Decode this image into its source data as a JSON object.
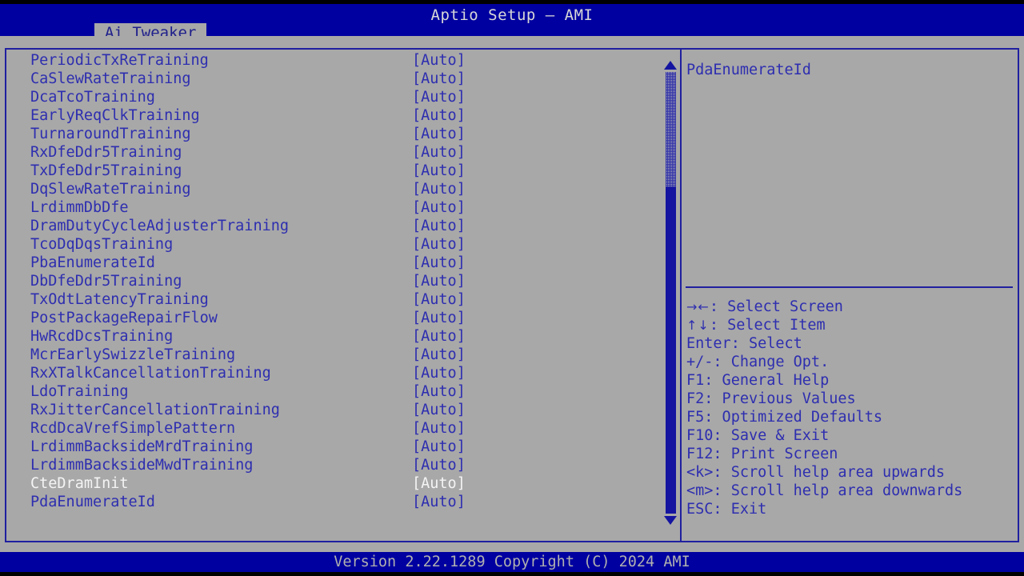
{
  "header": {
    "title": "Aptio Setup – AMI"
  },
  "tabs": [
    {
      "label": "Ai Tweaker",
      "active": true
    }
  ],
  "settings": {
    "selected_index": 23,
    "rows": [
      {
        "label": "PeriodicTxReTraining",
        "value": "[Auto]"
      },
      {
        "label": "CaSlewRateTraining",
        "value": "[Auto]"
      },
      {
        "label": "DcaTcoTraining",
        "value": "[Auto]"
      },
      {
        "label": "EarlyReqClkTraining",
        "value": "[Auto]"
      },
      {
        "label": "TurnaroundTraining",
        "value": "[Auto]"
      },
      {
        "label": "RxDfeDdr5Training",
        "value": "[Auto]"
      },
      {
        "label": "TxDfeDdr5Training",
        "value": "[Auto]"
      },
      {
        "label": "DqSlewRateTraining",
        "value": "[Auto]"
      },
      {
        "label": "LrdimmDbDfe",
        "value": "[Auto]"
      },
      {
        "label": "DramDutyCycleAdjusterTraining",
        "value": "[Auto]"
      },
      {
        "label": "TcoDqDqsTraining",
        "value": "[Auto]"
      },
      {
        "label": "PbaEnumerateId",
        "value": "[Auto]"
      },
      {
        "label": "DbDfeDdr5Training",
        "value": "[Auto]"
      },
      {
        "label": "TxOdtLatencyTraining",
        "value": "[Auto]"
      },
      {
        "label": "PostPackageRepairFlow",
        "value": "[Auto]"
      },
      {
        "label": "HwRcdDcsTraining",
        "value": "[Auto]"
      },
      {
        "label": "McrEarlySwizzleTraining",
        "value": "[Auto]"
      },
      {
        "label": "RxXTalkCancellationTraining",
        "value": "[Auto]"
      },
      {
        "label": "LdoTraining",
        "value": "[Auto]"
      },
      {
        "label": "RxJitterCancellationTraining",
        "value": "[Auto]"
      },
      {
        "label": "RcdDcaVrefSimplePattern",
        "value": "[Auto]"
      },
      {
        "label": "LrdimmBacksideMrdTraining",
        "value": "[Auto]"
      },
      {
        "label": "LrdimmBacksideMwdTraining",
        "value": "[Auto]"
      },
      {
        "label": "CteDramInit",
        "value": "[Auto]"
      },
      {
        "label": "PdaEnumerateId",
        "value": "[Auto]"
      }
    ]
  },
  "scrollbar": {
    "up_arrow_icon": "triangle-up-icon",
    "down_arrow_icon": "triangle-down-icon"
  },
  "help": {
    "title": "PdaEnumerateId",
    "keys": [
      {
        "glyph": "→←",
        "text": ": Select Screen"
      },
      {
        "glyph": "↑↓",
        "text": ": Select Item"
      },
      {
        "glyph": "",
        "text": "Enter: Select"
      },
      {
        "glyph": "",
        "text": "+/-: Change Opt."
      },
      {
        "glyph": "",
        "text": "F1: General Help"
      },
      {
        "glyph": "",
        "text": "F2: Previous Values"
      },
      {
        "glyph": "",
        "text": "F5: Optimized Defaults"
      },
      {
        "glyph": "",
        "text": "F10: Save & Exit"
      },
      {
        "glyph": "",
        "text": "F12: Print Screen"
      },
      {
        "glyph": "",
        "text": "<k>: Scroll help area upwards"
      },
      {
        "glyph": "",
        "text": "<m>: Scroll help area downwards"
      },
      {
        "glyph": "",
        "text": "ESC: Exit"
      }
    ]
  },
  "footer": {
    "text": "Version 2.22.1289 Copyright (C) 2024 AMI"
  },
  "colors": {
    "header_blue": "#0000a0",
    "panel_gray": "#a8a8a8",
    "frame_blue": "#2020a0",
    "text_blue": "#2e2eb0",
    "selected_text": "#f4f4f4",
    "header_text": "#d8d8d8"
  }
}
